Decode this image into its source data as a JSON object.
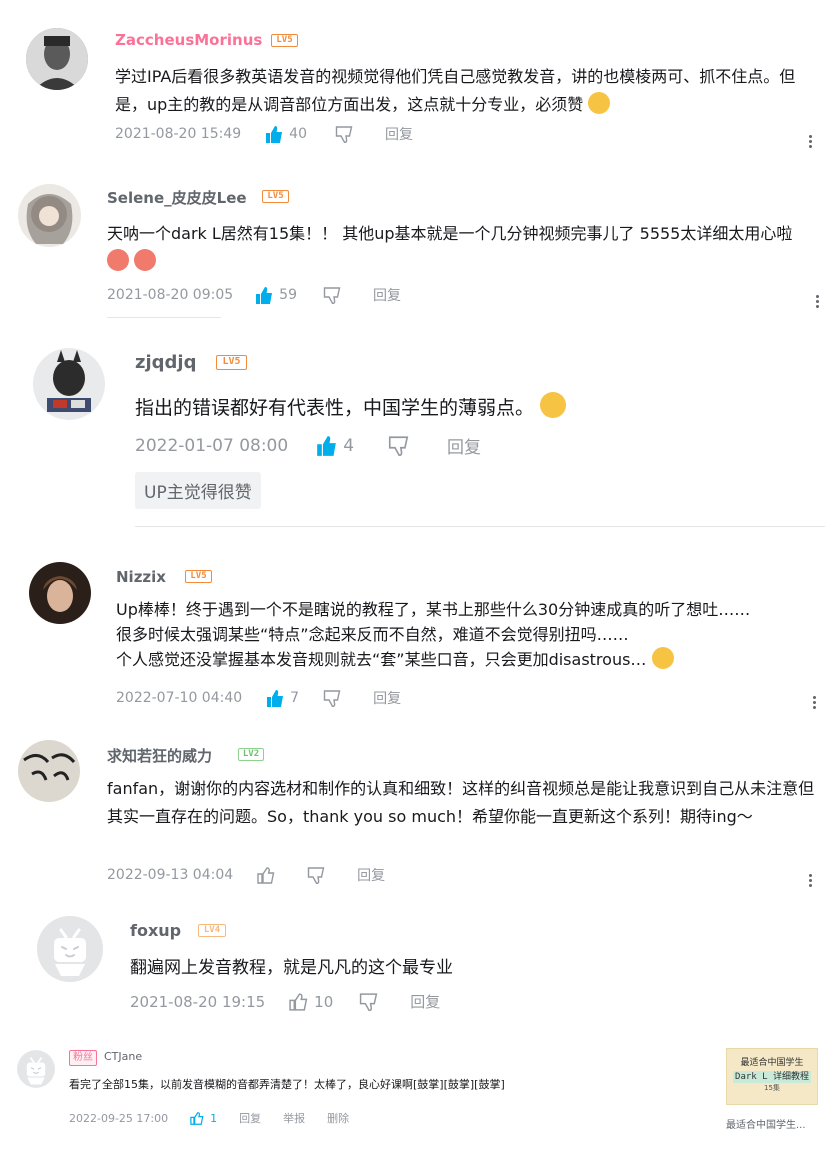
{
  "comments": [
    {
      "user": "ZaccheusMorinus",
      "level": "LV5",
      "text": "学过IPA后看很多教英语发音的视频觉得他们凭自己感觉教发音，讲的也模棱两可、抓不住点。但是，up主的教的是从调音部位方面出发，这点就十分专业，必须赞",
      "time": "2021-08-20 15:49",
      "likes": "40",
      "reply": "回复"
    },
    {
      "user": "Selene_皮皮皮Lee",
      "level": "LV5",
      "text": "天呐一个dark L居然有15集！！  其他up基本就是一个几分钟视频完事儿了 5555太详细太用心啦",
      "time": "2021-08-20 09:05",
      "likes": "59",
      "reply": "回复"
    },
    {
      "user": "zjqdjq",
      "level": "LV5",
      "text": "指出的错误都好有代表性，中国学生的薄弱点。",
      "time": "2022-01-07 08:00",
      "likes": "4",
      "reply": "回复",
      "tag": "UP主觉得很赞"
    },
    {
      "user": "Nizzix",
      "level": "LV5",
      "line1": "Up棒棒！终于遇到一个不是瞎说的教程了，某书上那些什么30分钟速成真的听了想吐……",
      "line2": "很多时候太强调某些“特点”念起来反而不自然，难道不会觉得别扭吗……",
      "line3": "个人感觉还没掌握基本发音规则就去“套”某些口音，只会更加disastrous…",
      "time": "2022-07-10 04:40",
      "likes": "7",
      "reply": "回复"
    },
    {
      "user": "求知若狂的威力",
      "level": "LV2",
      "text": "fanfan，谢谢你的内容选材和制作的认真和细致！这样的纠音视频总是能让我意识到自己从未注意但其实一直存在的问题。So，thank you so much！希望你能一直更新这个系列！期待ing～",
      "time": "2022-09-13 04:04",
      "reply": "回复"
    },
    {
      "user": "foxup",
      "level": "LV4",
      "text": "翻遍网上发音教程，就是凡凡的这个最专业",
      "time": "2021-08-20 19:15",
      "likes": "10",
      "reply": "回复"
    },
    {
      "badge": "粉丝",
      "user": "CTJane",
      "text": "看完了全部15集，以前发音模糊的音都弄清楚了！太棒了，良心好课啊[鼓掌][鼓掌][鼓掌]",
      "time": "2022-09-25 17:00",
      "likes": "1",
      "reply": "回复",
      "report": "举报",
      "delete": "删除",
      "video_thumb_line1": "最适合中国学生",
      "video_thumb_line2": "Dark L 详细教程",
      "video_thumb_line3": "15集",
      "video_title": "最适合中国学生..."
    }
  ],
  "colors": {
    "like_active": "#00aeec",
    "meta_gray": "#9499a0",
    "level_orange": "#f28c3c",
    "level_green": "#6cc26c",
    "divider": "#e3e5e7"
  }
}
